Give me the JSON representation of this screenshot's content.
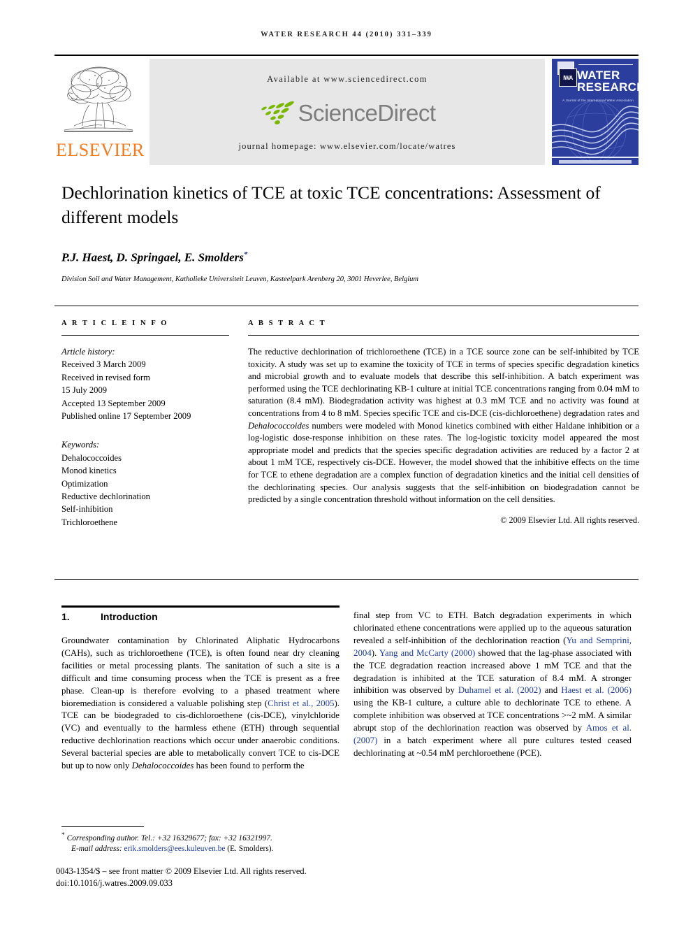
{
  "running_head": "WATER RESEARCH 44 (2010) 331–339",
  "masthead": {
    "publisher_name": "ELSEVIER",
    "available_at": "Available at www.sciencedirect.com",
    "sciencedirect_wordmark": "ScienceDirect",
    "journal_homepage": "journal homepage: www.elsevier.com/locate/watres",
    "cover": {
      "line1": "WATER",
      "line2": "RESEARCH",
      "tagline": "A Journal of the International Water Association",
      "association_mark": "IWA"
    }
  },
  "article": {
    "title": "Dechlorination kinetics of TCE at toxic TCE concentrations: Assessment of different models",
    "authors": "P.J. Haest, D. Springael, E. Smolders",
    "corresponding_marker": "*",
    "affiliation": "Division Soil and Water Management, Katholieke Universiteit Leuven, Kasteelpark Arenberg 20, 3001 Heverlee, Belgium"
  },
  "article_info": {
    "heading": "A R T I C L E  I N F O",
    "history_label": "Article history:",
    "history": [
      "Received 3 March 2009",
      "Received in revised form",
      "15 July 2009",
      "Accepted 13 September 2009",
      "Published online 17 September 2009"
    ],
    "keywords_label": "Keywords:",
    "keywords": [
      "Dehalococcoides",
      "Monod kinetics",
      "Optimization",
      "Reductive dechlorination",
      "Self-inhibition",
      "Trichloroethene"
    ]
  },
  "abstract": {
    "heading": "A B S T R A C T",
    "p1_a": "The reductive dechlorination of trichloroethene (TCE) in a TCE source zone can be self-inhibited by TCE toxicity. A study was set up to examine the toxicity of TCE in terms of species specific degradation kinetics and microbial growth and to evaluate models that describe this self-inhibition. A batch experiment was performed using the TCE dechlorinating KB-1 culture at initial TCE concentrations ranging from 0.04 mM to saturation (8.4 mM). Biodegradation activity was highest at 0.3 mM TCE and no activity was found at concentrations from 4 to 8 mM. Species specific TCE and cis-DCE (cis-dichloroethene) degradation rates and ",
    "p1_italic": "Dehalococcoides",
    "p1_b": " numbers were modeled with Monod kinetics combined with either Haldane inhibition or a log-logistic dose-response inhibition on these rates. The log-logistic toxicity model appeared the most appropriate model and predicts that the species specific degradation activities are reduced by a factor 2 at about 1 mM TCE, respectively cis-DCE. However, the model showed that the inhibitive effects on the time for TCE to ethene degradation are a complex function of degradation kinetics and the initial cell densities of the dechlorinating species. Our analysis suggests that the self-inhibition on biodegradation cannot be predicted by a single concentration threshold without information on the cell densities.",
    "copyright": "© 2009 Elsevier Ltd. All rights reserved."
  },
  "body": {
    "section_number": "1.",
    "section_title": "Introduction",
    "left_column": {
      "s1": "Groundwater contamination by Chlorinated Aliphatic Hydrocarbons (CAHs), such as trichloroethene (TCE), is often found near dry cleaning facilities or metal processing plants. The sanitation of such a site is a difficult and time consuming process when the TCE is present as a free phase. Clean-up is therefore evolving to a phased treatment where bioremediation is considered a valuable polishing step (",
      "cite1": "Christ et al., 2005",
      "s2": "). TCE can be biodegraded to cis-dichloroethene (cis-DCE), vinylchloride (VC) and eventually to the harmless ethene (ETH) through sequential reductive dechlorination reactions which occur under anaerobic conditions. Several bacterial species are able to metabolically convert TCE to cis-DCE but up to now only ",
      "italic1": "Dehalococcoides",
      "s3": " has been found to perform the"
    },
    "right_column": {
      "s1": "final step from VC to ETH. Batch degradation experiments in which chlorinated ethene concentrations were applied up to the aqueous saturation revealed a self-inhibition of the dechlorination reaction (",
      "cite1": "Yu and Semprini, 2004",
      "s2": "). ",
      "cite2": "Yang and McCarty (2000)",
      "s3": " showed that the lag-phase associated with the TCE degradation reaction increased above 1 mM TCE and that the degradation is inhibited at the TCE saturation of 8.4 mM. A stronger inhibition was observed by ",
      "cite3": "Duhamel et al. (2002)",
      "s4": " and ",
      "cite4": "Haest et al. (2006)",
      "s5": " using the KB-1 culture, a culture able to dechlorinate TCE to ethene. A complete inhibition was observed at TCE concentrations >~2 mM. A similar abrupt stop of the dechlorination reaction was observed by ",
      "cite5": "Amos et al. (2007)",
      "s6": " in a batch experiment where all pure cultures tested ceased dechlorinating at ~0.54 mM perchloroethene (PCE)."
    }
  },
  "footer": {
    "corresponding_marker": "*",
    "corresponding": "Corresponding author. Tel.: +32 16329677; fax: +32 16321997.",
    "email_label": "E-mail address: ",
    "email": "erik.smolders@ees.kuleuven.be",
    "email_suffix": " (E. Smolders).",
    "front_matter": "0043-1354/$ – see front matter © 2009 Elsevier Ltd. All rights reserved.",
    "doi": "doi:10.1016/j.watres.2009.09.033"
  },
  "colors": {
    "elsevier_orange": "#F47B20",
    "cover_blue": "#2B3E9E",
    "citation_blue": "#1d3c9c",
    "sciencedirect_green": "#7AB800",
    "banner_gray": "#e7e7e7"
  }
}
